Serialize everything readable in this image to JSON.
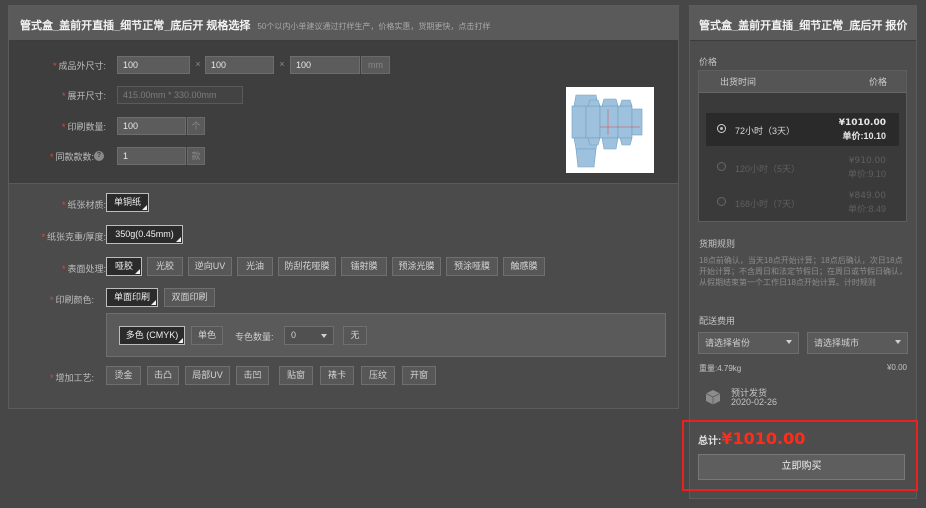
{
  "spec": {
    "title": "管式盒_盖前开直插_细节正常_底后开 规格选择",
    "subtitle": "50个以内小单建议通过打样生产，价格实惠，货期更快，点击打样",
    "size_label": "成品外尺寸:",
    "length": "100",
    "width": "100",
    "height": "100",
    "times": "×",
    "size_unit": "mm",
    "unfold_label": "展开尺寸:",
    "unfold_value": "415.00mm * 330.00mm",
    "qty_label": "印刷数量:",
    "qty_value": "100",
    "qty_unit": "个",
    "styles_label": "同款款数:",
    "styles_help": "?",
    "styles_value": "1",
    "styles_unit": "款",
    "paper_label": "纸张材质:",
    "paper_options": [
      "单铜纸"
    ],
    "weight_label": "纸张克重/厚度:",
    "weight_options": [
      "350g(0.45mm)"
    ],
    "surface_label": "表面处理:",
    "surface_options": [
      "哑胶",
      "光胶",
      "逆向UV",
      "光油",
      "防刮花哑膜",
      "镭射膜",
      "预涂光膜",
      "预涂哑膜",
      "触感膜"
    ],
    "print_color_label": "印刷颜色:",
    "print_sides": [
      "单面印刷",
      "双面印刷"
    ],
    "color_modes": [
      "多色 (CMYK)",
      "单色"
    ],
    "spot_label": "专色数量:",
    "spot_value": "0",
    "spot_none": "无",
    "craft_label": "增加工艺:",
    "craft_options": [
      "烫金",
      "击凸",
      "局部UV",
      "击凹",
      "贴窗",
      "裱卡",
      "压纹",
      "开窗"
    ]
  },
  "quote": {
    "title": "管式盒_盖前开直插_细节正常_底后开 报价",
    "price_label": "价格",
    "col_time": "出货时间",
    "col_price": "价格",
    "rows": [
      {
        "time": "72小时（3天）",
        "price": "¥1010.00",
        "unit": "单价:10.10"
      },
      {
        "time": "120小时（5天）",
        "price": "¥910.00",
        "unit": "单价:9.10"
      },
      {
        "time": "168小时（7天）",
        "price": "¥849.00",
        "unit": "单价:8.49"
      }
    ],
    "rules_title": "货期规则",
    "rules_text": "18点前确认，当天18点开始计算；18点后确认，次日18点开始计算；不含周日和法定节假日；在周日或节假日确认，从假期结束第一个工作日18点开始计算。",
    "rules_link": "计时规则",
    "delivery_title": "配送费用",
    "province_placeholder": "请选择省份",
    "city_placeholder": "请选择城市",
    "weight": "重量:4.79kg",
    "shipping_fee": "¥0.00",
    "ship_label": "预计发货",
    "ship_date": "2020-02-26",
    "total_label": "总计:",
    "total_value": "¥1010.00",
    "buy_label": "立即购买"
  },
  "colors": {
    "total_red": "#ff2c1a",
    "highlight_frame": "#e8231d",
    "required_star": "#e0483e"
  }
}
